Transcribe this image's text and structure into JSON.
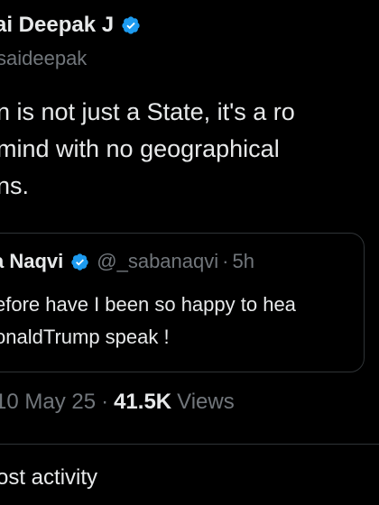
{
  "tweet": {
    "author_name": "ai Deepak J",
    "author_handle": "saideepak",
    "text_lines": [
      "n is not just a State, it's a ro",
      "mind with no geographical",
      "ns."
    ],
    "quoted": {
      "author_name": "a Naqvi",
      "author_handle": "@_sabanaqvi",
      "separator": "·",
      "time": "5h",
      "text_lines": [
        "efore have I been so happy to hea",
        "onaldTrump speak !"
      ]
    },
    "meta": {
      "date": "10 May 25",
      "separator": "·",
      "views_count": "41.5K",
      "views_label": "Views"
    }
  },
  "post_activity_label": "ost activity",
  "colors": {
    "background": "#000000",
    "text_primary": "#e7e9ea",
    "text_secondary": "#71767b",
    "verified_blue": "#1d9bf0",
    "border": "#2f3336"
  },
  "icons": {
    "verified": "verified-badge-icon"
  }
}
